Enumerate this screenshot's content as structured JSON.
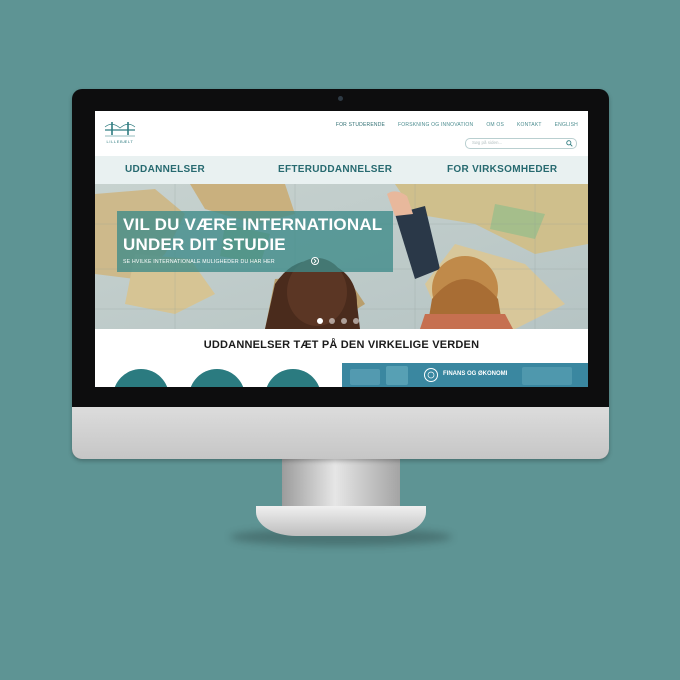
{
  "site": {
    "logo_text": "LILLEBÆLT",
    "top_nav": [
      "FOR STUDERENDE",
      "FORSKNING OG INNOVATION",
      "OM OS",
      "KONTAKT",
      "ENGLISH"
    ],
    "search_placeholder": "Søg på siden...",
    "main_nav": [
      "UDDANNELSER",
      "EFTERUDDANNELSER",
      "FOR VIRKSOMHEDER"
    ],
    "hero": {
      "title": "VIL DU VÆRE INTERNATIONAL\nUNDER DIT STUDIE",
      "subtitle": "SE HVILKE INTERNATIONALE MULIGHEDER DU HAR HER",
      "slide_count": 4,
      "active_slide": 1
    },
    "section_title": "UDDANNELSER TÆT PÅ DEN VIRKELIGE VERDEN",
    "tile_label": "FINANS OG ØKONOMI"
  },
  "colors": {
    "background": "#5e9494",
    "brand_teal": "#276a70",
    "hero_overlay": "#3d8a89",
    "circle": "#2b7b80"
  }
}
